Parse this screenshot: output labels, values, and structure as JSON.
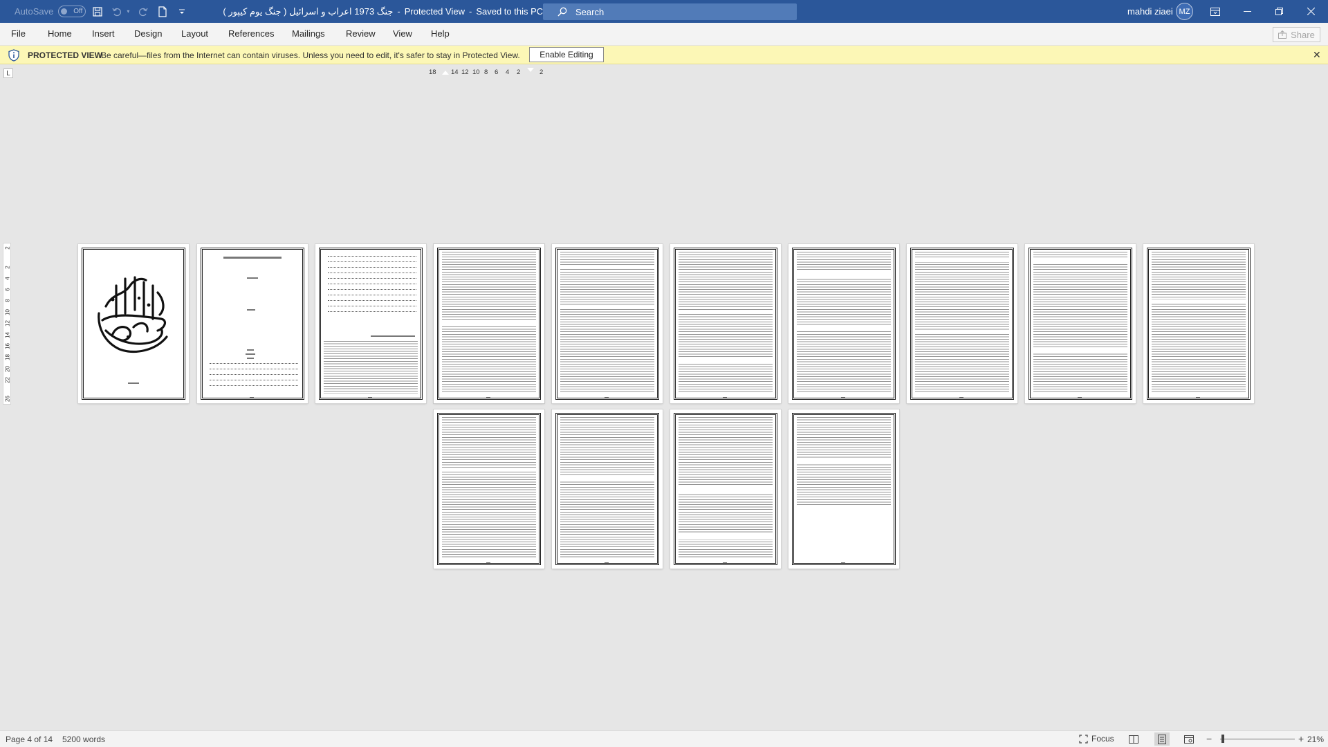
{
  "titlebar": {
    "autosave_label": "AutoSave",
    "autosave_state": "Off",
    "doc_title": "جنگ 1973 اعراب و اسرائیل ( جنگ یوم کیپور )",
    "protected_label": "Protected View",
    "saved_label": "Saved to this PC",
    "search_placeholder": "Search",
    "user_name": "mahdi ziaei",
    "user_initials": "MZ"
  },
  "menu": {
    "file": "File",
    "home": "Home",
    "insert": "Insert",
    "design": "Design",
    "layout": "Layout",
    "references": "References",
    "mailings": "Mailings",
    "review": "Review",
    "view": "View",
    "help": "Help",
    "share": "Share"
  },
  "protected_view": {
    "title": "PROTECTED VIEW",
    "message": "Be careful—files from the Internet can contain viruses. Unless you need to edit, it's safer to stay in Protected View.",
    "enable_button": "Enable Editing"
  },
  "ruler": {
    "tab_selector": "L",
    "horizontal_ticks": [
      "18",
      "14",
      "12",
      "10",
      "8",
      "6",
      "4",
      "2",
      "2"
    ],
    "vertical_ticks": [
      "2",
      "2",
      "4",
      "6",
      "8",
      "10",
      "12",
      "14",
      "16",
      "18",
      "20",
      "22",
      "26"
    ]
  },
  "document": {
    "page_count": 14,
    "selected_page": 4
  },
  "status": {
    "page_info": "Page 4 of 14",
    "word_count": "5200 words",
    "focus_label": "Focus",
    "zoom": "21%"
  },
  "colors": {
    "titlebar_bg": "#2b579a",
    "protected_bar_bg": "#fcf7b6"
  }
}
